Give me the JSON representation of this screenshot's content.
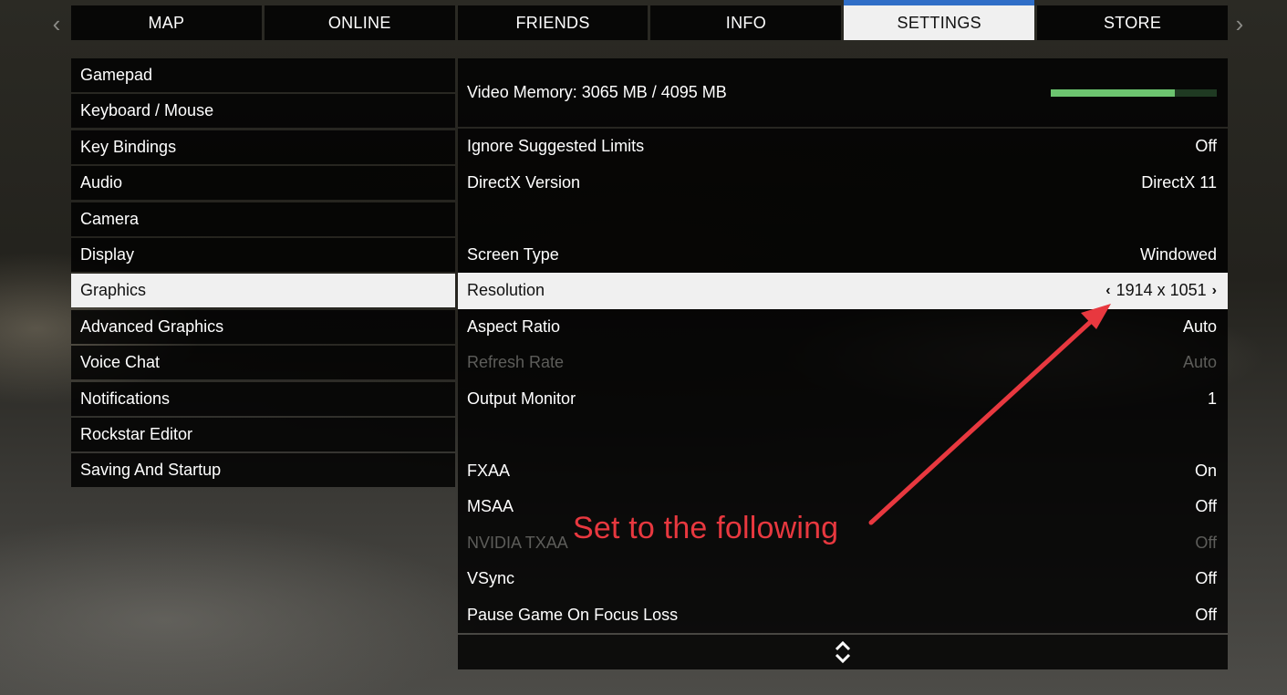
{
  "tabs": [
    "MAP",
    "ONLINE",
    "FRIENDS",
    "INFO",
    "SETTINGS",
    "STORE"
  ],
  "active_tab": "SETTINGS",
  "sidebar": {
    "items": [
      {
        "label": "Gamepad"
      },
      {
        "label": "Keyboard / Mouse"
      },
      {
        "label": "Key Bindings"
      },
      {
        "label": "Audio"
      },
      {
        "label": "Camera"
      },
      {
        "label": "Display"
      },
      {
        "label": "Graphics",
        "active": true
      },
      {
        "label": "Advanced Graphics"
      },
      {
        "label": "Voice Chat"
      },
      {
        "label": "Notifications"
      },
      {
        "label": "Rockstar Editor"
      },
      {
        "label": "Saving And Startup"
      }
    ]
  },
  "video_memory": {
    "label": "Video Memory: 3065 MB / 4095 MB",
    "used_mb": 3065,
    "total_mb": 4095,
    "bar_color": "#6cc46f"
  },
  "settings": [
    {
      "label": "Ignore Suggested Limits",
      "value": "Off"
    },
    {
      "label": "DirectX Version",
      "value": "DirectX 11"
    },
    {
      "spacer": true
    },
    {
      "label": "Screen Type",
      "value": "Windowed"
    },
    {
      "label": "Resolution",
      "value": "1914 x 1051",
      "active": true,
      "arrows": true
    },
    {
      "label": "Aspect Ratio",
      "value": "Auto"
    },
    {
      "label": "Refresh Rate",
      "value": "Auto",
      "disabled": true
    },
    {
      "label": "Output Monitor",
      "value": "1"
    },
    {
      "spacer": true
    },
    {
      "label": "FXAA",
      "value": "On"
    },
    {
      "label": "MSAA",
      "value": "Off"
    },
    {
      "label": "NVIDIA TXAA",
      "value": "Off",
      "disabled": true
    },
    {
      "label": "VSync",
      "value": "Off"
    },
    {
      "label": "Pause Game On Focus Loss",
      "value": "Off"
    }
  ],
  "annotation": {
    "text": "Set to the following",
    "color": "#e8383f"
  },
  "icons": {
    "nav_left": "chevron-left-icon",
    "nav_right": "chevron-right-icon",
    "scroll": "scroll-updown-icon"
  }
}
